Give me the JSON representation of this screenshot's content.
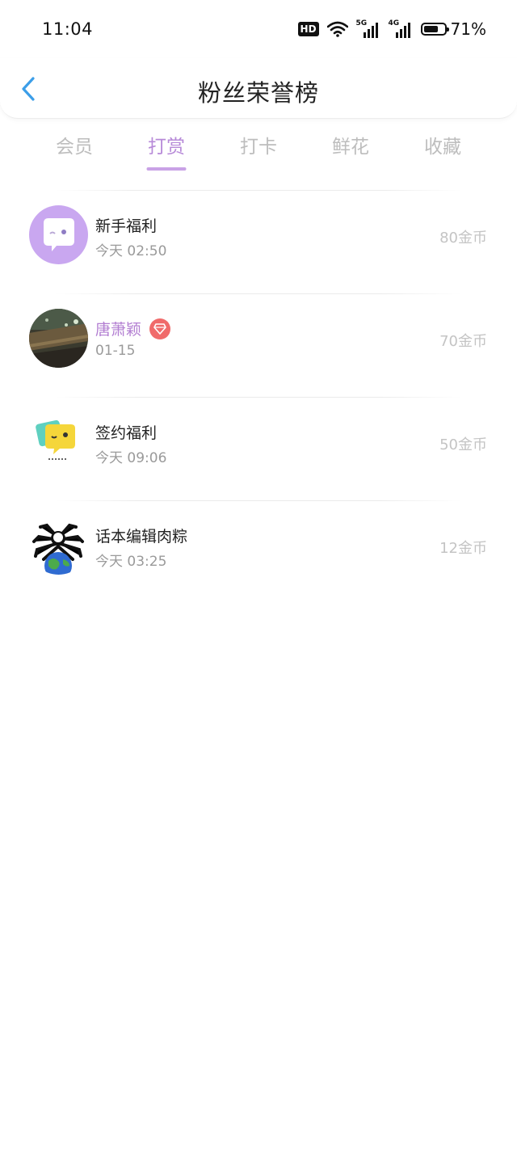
{
  "status_bar": {
    "time": "11:04",
    "hd_label": "HD",
    "net1": "5G",
    "net2": "4G",
    "battery_percent_text": "71%",
    "battery_level": 0.71
  },
  "header": {
    "title": "粉丝荣誉榜",
    "back_icon": "chevron-left-icon",
    "accent_color": "#3c9ee8"
  },
  "tabs": [
    {
      "label": "会员",
      "active": false
    },
    {
      "label": "打赏",
      "active": true
    },
    {
      "label": "打卡",
      "active": false
    },
    {
      "label": "鲜花",
      "active": false
    },
    {
      "label": "收藏",
      "active": false
    }
  ],
  "active_color": "#b78ad8",
  "list": [
    {
      "name": "新手福利",
      "date": "今天 02:50",
      "amount": "80金币",
      "avatar": "chat-bubble-icon"
    },
    {
      "name": "唐萧颖",
      "date": "01-15",
      "amount": "70金币",
      "avatar": "photo-avatar",
      "vip": true,
      "badge_icon": "diamond-icon"
    },
    {
      "name": "签约福利",
      "date": "今天 09:06",
      "amount": "50金币",
      "avatar": "wink-bubble-icon"
    },
    {
      "name": "话本编辑肉粽",
      "date": "今天 03:25",
      "amount": "12金币",
      "avatar": "spider-globe-avatar"
    }
  ]
}
